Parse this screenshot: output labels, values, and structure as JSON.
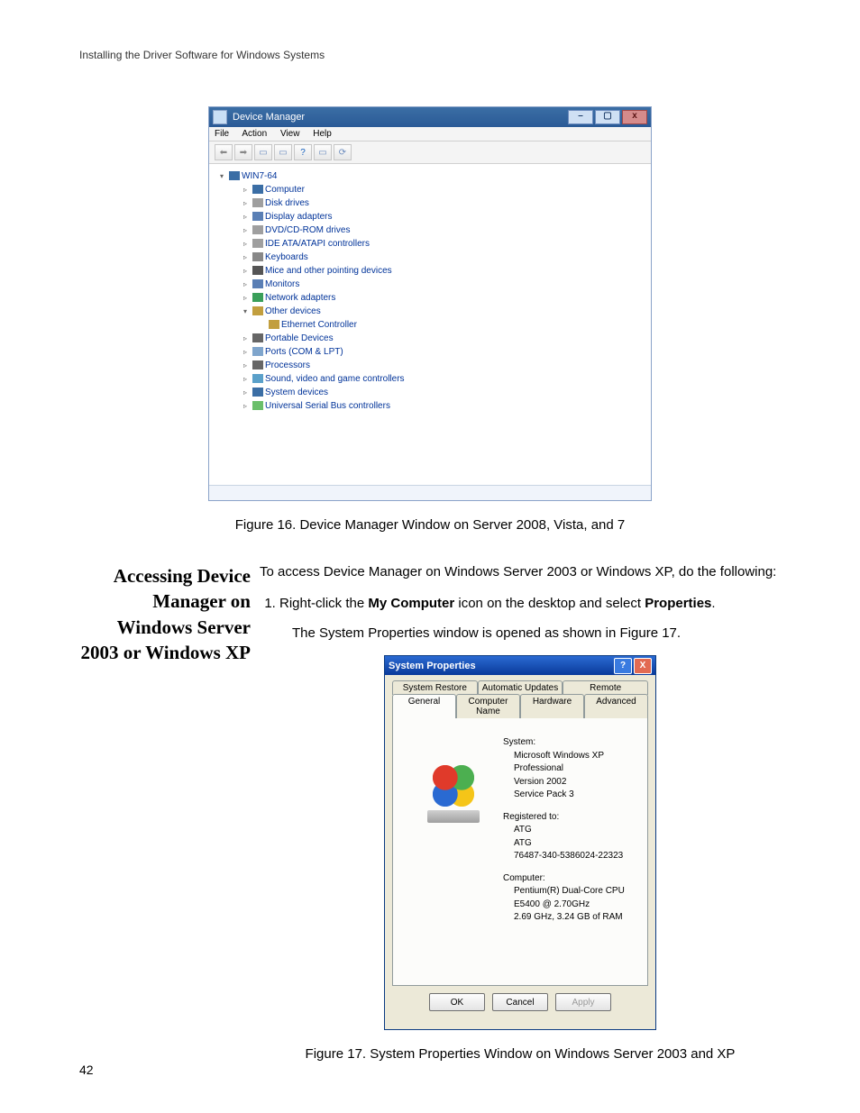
{
  "running_header": "Installing the Driver Software for Windows Systems",
  "page_number": "42",
  "fig16_caption": "Figure 16. Device Manager Window on Server 2008, Vista, and 7",
  "fig17_caption": "Figure 17. System Properties Window on Windows Server 2003 and XP",
  "section_heading": "Accessing Device Manager on Windows Server 2003 or Windows XP",
  "intro": "To access Device Manager on Windows Server 2003 or Windows XP, do the following:",
  "step1_pre": "Right-click the ",
  "step1_bold": "My Computer",
  "step1_mid": " icon on the desktop and select ",
  "step1_bold2": "Properties",
  "step1_post": ".",
  "step1_note": "The System Properties window is opened as shown in Figure 17.",
  "devmgr": {
    "title": "Device Manager",
    "menu": {
      "file": "File",
      "action": "Action",
      "view": "View",
      "help": "Help"
    },
    "root": "WIN7-64",
    "items": {
      "computer": "Computer",
      "disk": "Disk drives",
      "display": "Display adapters",
      "dvd": "DVD/CD-ROM drives",
      "ide": "IDE ATA/ATAPI controllers",
      "keyboard": "Keyboards",
      "mice": "Mice and other pointing devices",
      "monitors": "Monitors",
      "network": "Network adapters",
      "other": "Other devices",
      "ethernet": "Ethernet Controller",
      "portable": "Portable Devices",
      "ports": "Ports (COM & LPT)",
      "processors": "Processors",
      "sound": "Sound, video and game controllers",
      "system": "System devices",
      "usb": "Universal Serial Bus controllers"
    }
  },
  "sysprops": {
    "title": "System Properties",
    "tabs": {
      "system_restore": "System Restore",
      "automatic_updates": "Automatic Updates",
      "remote": "Remote",
      "general": "General",
      "computer_name": "Computer Name",
      "hardware": "Hardware",
      "advanced": "Advanced"
    },
    "labels": {
      "system": "System:",
      "registered": "Registered to:",
      "computer": "Computer:"
    },
    "system": {
      "l1": "Microsoft Windows XP",
      "l2": "Professional",
      "l3": "Version 2002",
      "l4": "Service Pack 3"
    },
    "registered": {
      "l1": "ATG",
      "l2": "ATG",
      "l3": "76487-340-5386024-22323"
    },
    "computer": {
      "l1": "Pentium(R) Dual-Core  CPU",
      "l2": "E5400  @ 2.70GHz",
      "l3": "2.69 GHz, 3.24 GB of RAM"
    },
    "buttons": {
      "ok": "OK",
      "cancel": "Cancel",
      "apply": "Apply"
    }
  }
}
